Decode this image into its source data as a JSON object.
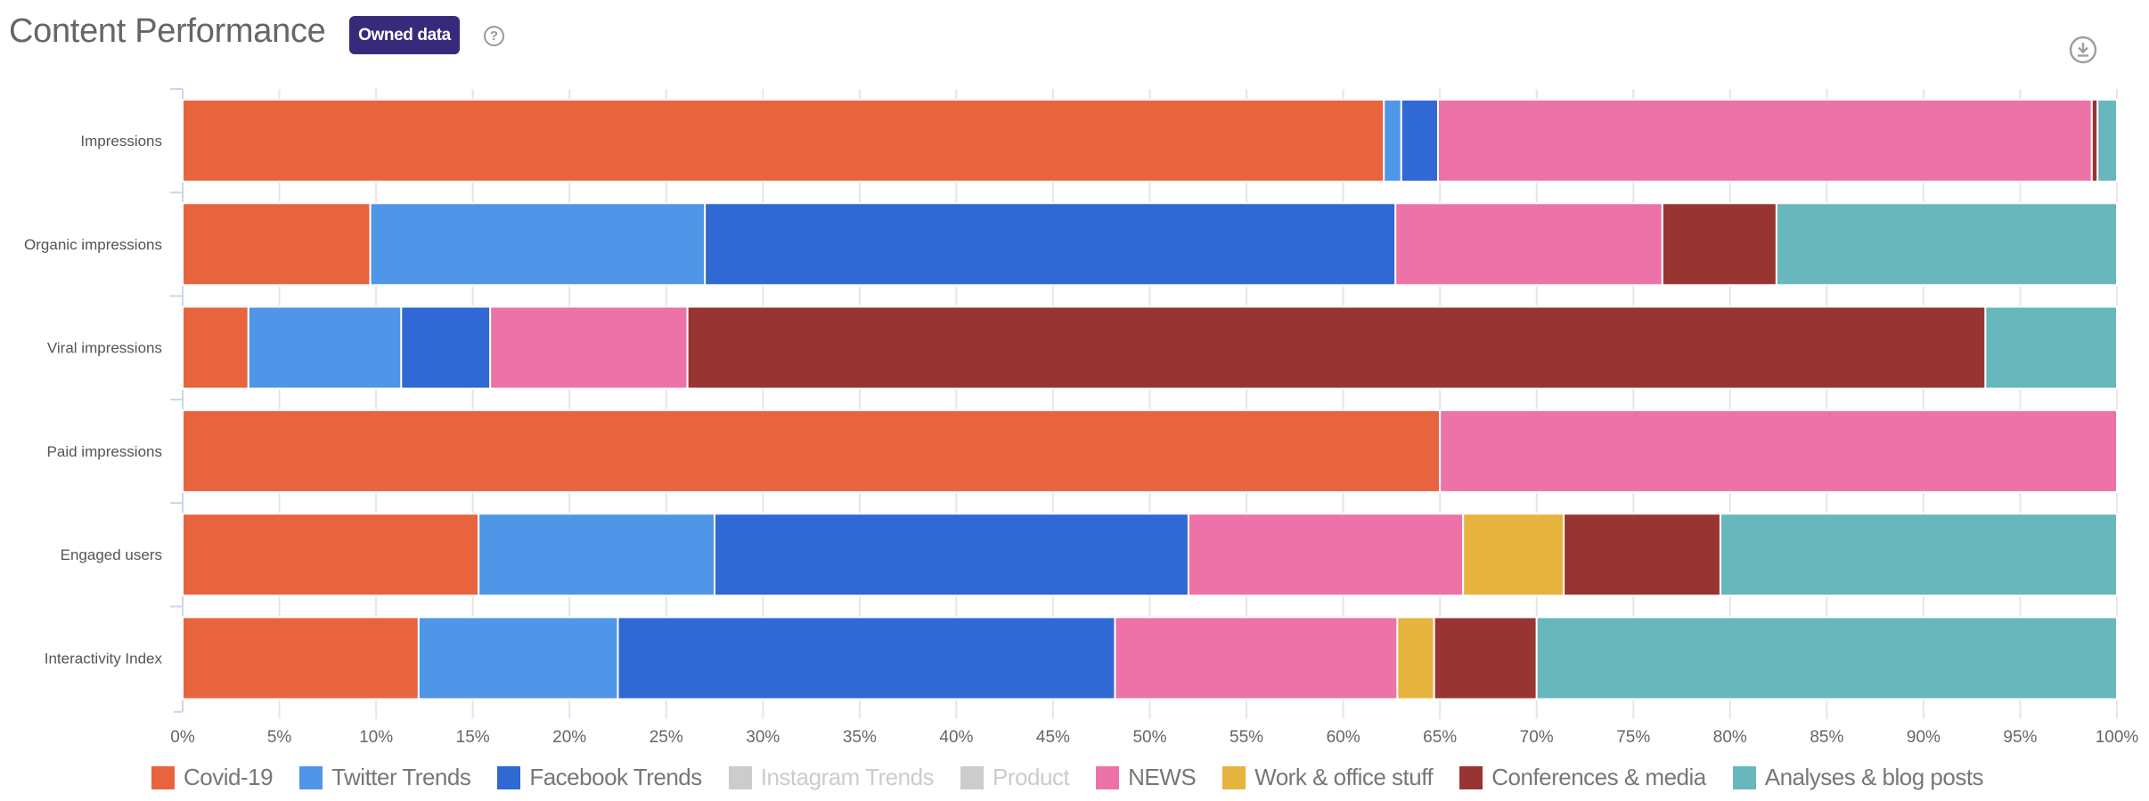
{
  "header": {
    "title": "Content Performance",
    "badge": "Owned data",
    "help_icon": "question-circle-icon",
    "download_icon": "download-circle-icon"
  },
  "chart_data": {
    "type": "bar",
    "orientation": "horizontal",
    "stacked": "percent",
    "title": "Content Performance",
    "xlabel": "",
    "ylabel": "",
    "xlim": [
      0,
      100
    ],
    "x_ticks": [
      "0%",
      "5%",
      "10%",
      "15%",
      "20%",
      "25%",
      "30%",
      "35%",
      "40%",
      "45%",
      "50%",
      "55%",
      "60%",
      "65%",
      "70%",
      "75%",
      "80%",
      "85%",
      "90%",
      "95%",
      "100%"
    ],
    "grid": true,
    "legend_position": "bottom",
    "categories": [
      "Impressions",
      "Organic impressions",
      "Viral impressions",
      "Paid impressions",
      "Engaged users",
      "Interactivity Index"
    ],
    "series": [
      {
        "name": "Covid-19",
        "color": "#e8643f",
        "enabled": true,
        "values": [
          62.1,
          9.7,
          3.4,
          65.0,
          15.3,
          12.2
        ]
      },
      {
        "name": "Twitter Trends",
        "color": "#4f96e8",
        "enabled": true,
        "values": [
          0.9,
          17.3,
          7.9,
          0,
          12.2,
          10.3
        ]
      },
      {
        "name": "Facebook Trends",
        "color": "#3068d4",
        "enabled": true,
        "values": [
          1.9,
          35.7,
          4.6,
          0,
          24.5,
          25.7
        ]
      },
      {
        "name": "Instagram Trends",
        "color": "#cccccc",
        "enabled": false,
        "values": [
          0,
          0,
          0,
          0,
          0,
          0
        ]
      },
      {
        "name": "Product",
        "color": "#cccccc",
        "enabled": false,
        "values": [
          0,
          0,
          0,
          0,
          0,
          0
        ]
      },
      {
        "name": "NEWS",
        "color": "#ed72a8",
        "enabled": true,
        "values": [
          33.8,
          13.8,
          10.2,
          35.0,
          14.2,
          14.6
        ]
      },
      {
        "name": "Work & office stuff",
        "color": "#e6b33e",
        "enabled": true,
        "values": [
          0,
          0,
          0,
          0,
          5.2,
          1.9
        ]
      },
      {
        "name": "Conferences & media",
        "color": "#983532",
        "enabled": true,
        "values": [
          0.3,
          5.9,
          67.1,
          0,
          8.1,
          5.3
        ]
      },
      {
        "name": "Analyses & blog posts",
        "color": "#68b7bd",
        "enabled": true,
        "values": [
          1.0,
          17.6,
          6.8,
          0,
          20.5,
          30.0
        ]
      }
    ]
  }
}
